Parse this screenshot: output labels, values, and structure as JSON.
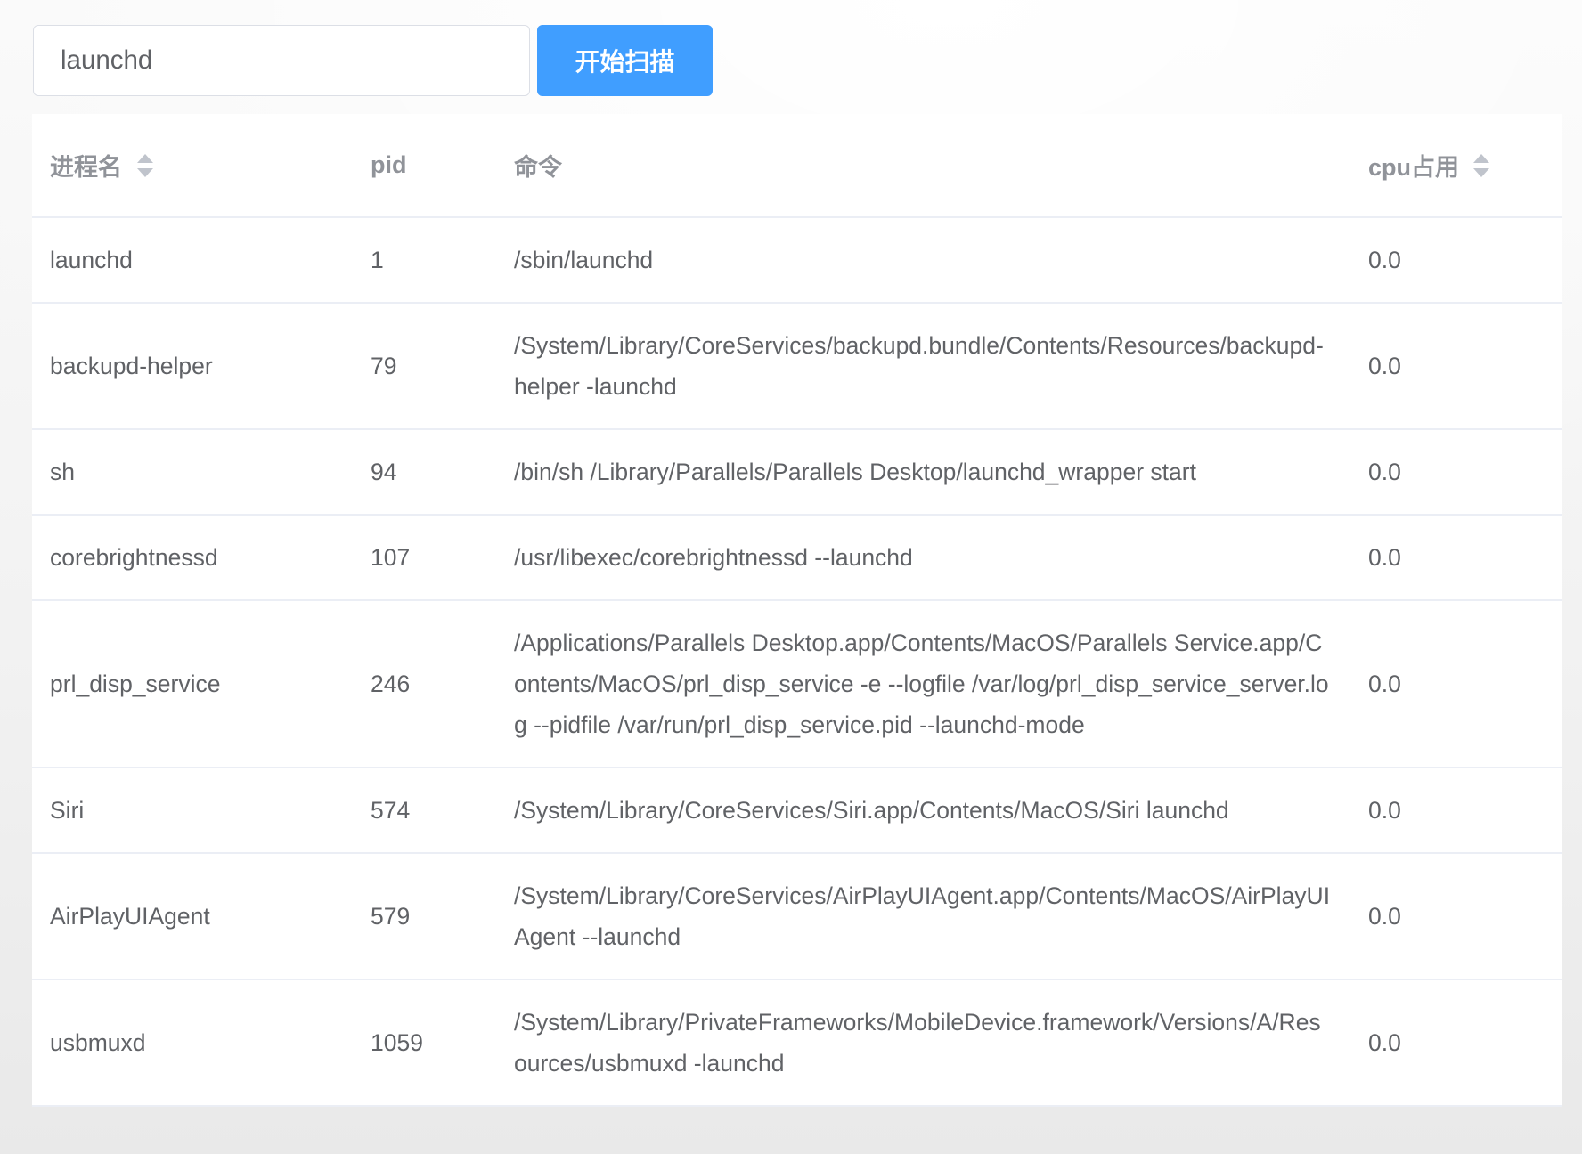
{
  "search": {
    "value": "launchd"
  },
  "scan_button": {
    "label": "开始扫描"
  },
  "table": {
    "columns": [
      {
        "label": "进程名",
        "sortable": true
      },
      {
        "label": "pid",
        "sortable": false
      },
      {
        "label": "命令",
        "sortable": false
      },
      {
        "label": "cpu占用",
        "sortable": true
      }
    ],
    "rows": [
      {
        "name": "launchd",
        "pid": "1",
        "command": "/sbin/launchd",
        "cpu": "0.0"
      },
      {
        "name": "backupd-helper",
        "pid": "79",
        "command": "/System/Library/CoreServices/backupd.bundle/Contents/Resources/backupd-helper -launchd",
        "cpu": "0.0"
      },
      {
        "name": "sh",
        "pid": "94",
        "command": "/bin/sh /Library/Parallels/Parallels Desktop/launchd_wrapper start",
        "cpu": "0.0"
      },
      {
        "name": "corebrightnessd",
        "pid": "107",
        "command": "/usr/libexec/corebrightnessd --launchd",
        "cpu": "0.0"
      },
      {
        "name": "prl_disp_service",
        "pid": "246",
        "command": "/Applications/Parallels Desktop.app/Contents/MacOS/Parallels Service.app/Contents/MacOS/prl_disp_service -e --logfile /var/log/prl_disp_service_server.log --pidfile /var/run/prl_disp_service.pid --launchd-mode",
        "cpu": "0.0"
      },
      {
        "name": "Siri",
        "pid": "574",
        "command": "/System/Library/CoreServices/Siri.app/Contents/MacOS/Siri launchd",
        "cpu": "0.0"
      },
      {
        "name": "AirPlayUIAgent",
        "pid": "579",
        "command": "/System/Library/CoreServices/AirPlayUIAgent.app/Contents/MacOS/AirPlayUIAgent --launchd",
        "cpu": "0.0"
      },
      {
        "name": "usbmuxd",
        "pid": "1059",
        "command": "/System/Library/PrivateFrameworks/MobileDevice.framework/Versions/A/Resources/usbmuxd -launchd",
        "cpu": "0.0"
      }
    ]
  },
  "icons": {
    "sort": "sort-caret-icon"
  },
  "colors": {
    "accent": "#409eff",
    "header_text": "#909399",
    "body_text": "#606266",
    "border": "#ebeef5",
    "sort_icon": "#c0c4cc"
  }
}
